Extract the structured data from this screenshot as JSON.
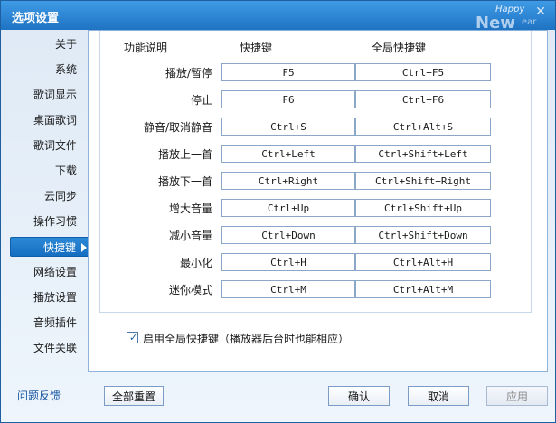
{
  "window": {
    "title": "选项设置",
    "close": "✕"
  },
  "brand": {
    "line1": "Happy",
    "line2": "New",
    "line3": "ear"
  },
  "sidebar": {
    "items": [
      {
        "label": "关于"
      },
      {
        "label": "系统"
      },
      {
        "label": "歌词显示"
      },
      {
        "label": "桌面歌词"
      },
      {
        "label": "歌词文件"
      },
      {
        "label": "下载"
      },
      {
        "label": "云同步"
      },
      {
        "label": "操作习惯"
      },
      {
        "label": "快捷键",
        "active": true
      },
      {
        "label": "网络设置"
      },
      {
        "label": "播放设置"
      },
      {
        "label": "音频插件"
      },
      {
        "label": "文件关联"
      }
    ]
  },
  "table": {
    "headers": [
      "功能说明",
      "快捷键",
      "全局快捷键"
    ],
    "rows": [
      {
        "name": "播放/暂停",
        "hotkey": "F5",
        "global": "Ctrl+F5"
      },
      {
        "name": "停止",
        "hotkey": "F6",
        "global": "Ctrl+F6"
      },
      {
        "name": "静音/取消静音",
        "hotkey": "Ctrl+S",
        "global": "Ctrl+Alt+S"
      },
      {
        "name": "播放上一首",
        "hotkey": "Ctrl+Left",
        "global": "Ctrl+Shift+Left"
      },
      {
        "name": "播放下一首",
        "hotkey": "Ctrl+Right",
        "global": "Ctrl+Shift+Right"
      },
      {
        "name": "增大音量",
        "hotkey": "Ctrl+Up",
        "global": "Ctrl+Shift+Up"
      },
      {
        "name": "减小音量",
        "hotkey": "Ctrl+Down",
        "global": "Ctrl+Shift+Down"
      },
      {
        "name": "最小化",
        "hotkey": "Ctrl+H",
        "global": "Ctrl+Alt+H"
      },
      {
        "name": "迷你模式",
        "hotkey": "Ctrl+M",
        "global": "Ctrl+Alt+M"
      }
    ]
  },
  "options": {
    "enable_global_label": "启用全局快捷键（播放器后台时也能相应）",
    "enable_global_checked": true,
    "check_mark": "✓"
  },
  "footer": {
    "feedback": "问题反馈",
    "reset": "全部重置",
    "ok": "确认",
    "cancel": "取消",
    "apply": "应用"
  },
  "colors": {
    "title_bar": "#1f73c3",
    "active_item": "#166ec0",
    "link": "#1c5aa5"
  }
}
